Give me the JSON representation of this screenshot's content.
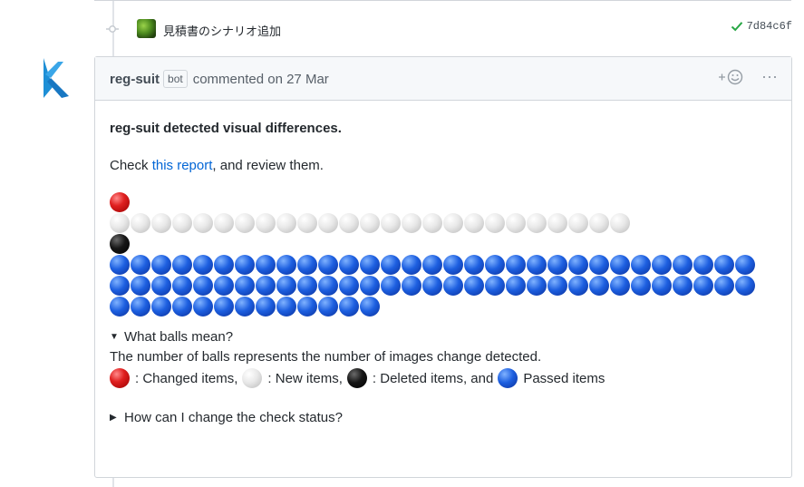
{
  "commit": {
    "message": "見積書のシナリオ追加",
    "sha": "7d84c6f",
    "status_color": "#28a745"
  },
  "comment": {
    "author": "reg-suit",
    "badge": "bot",
    "action": "commented on 27 Mar",
    "headline": "reg-suit detected visual differences.",
    "check_prefix": "Check ",
    "link_text": "this report",
    "check_suffix": ", and review them.",
    "balls": {
      "changed": 1,
      "new": 25,
      "deleted": 1,
      "passed": 75,
      "per_row": 31
    },
    "details1_summary": "What balls mean?",
    "details1_text": "The number of balls represents the number of images change detected.",
    "legend": {
      "changed": ": Changed items,",
      "new": ": New items,",
      "deleted": ": Deleted items, and",
      "passed": "Passed items"
    },
    "details2_summary": "How can I change the check status?"
  },
  "icons": {
    "commit": "git-commit-icon",
    "check": "check-icon",
    "reaction": "add-reaction-icon",
    "more": "kebab-icon",
    "bot_logo": "reg-suit-logo"
  },
  "colors": {
    "link": "#0366d6",
    "ball_red": "#e02020",
    "ball_white": "#e8e8e8",
    "ball_black": "#161616",
    "ball_blue": "#1d5fe0"
  }
}
